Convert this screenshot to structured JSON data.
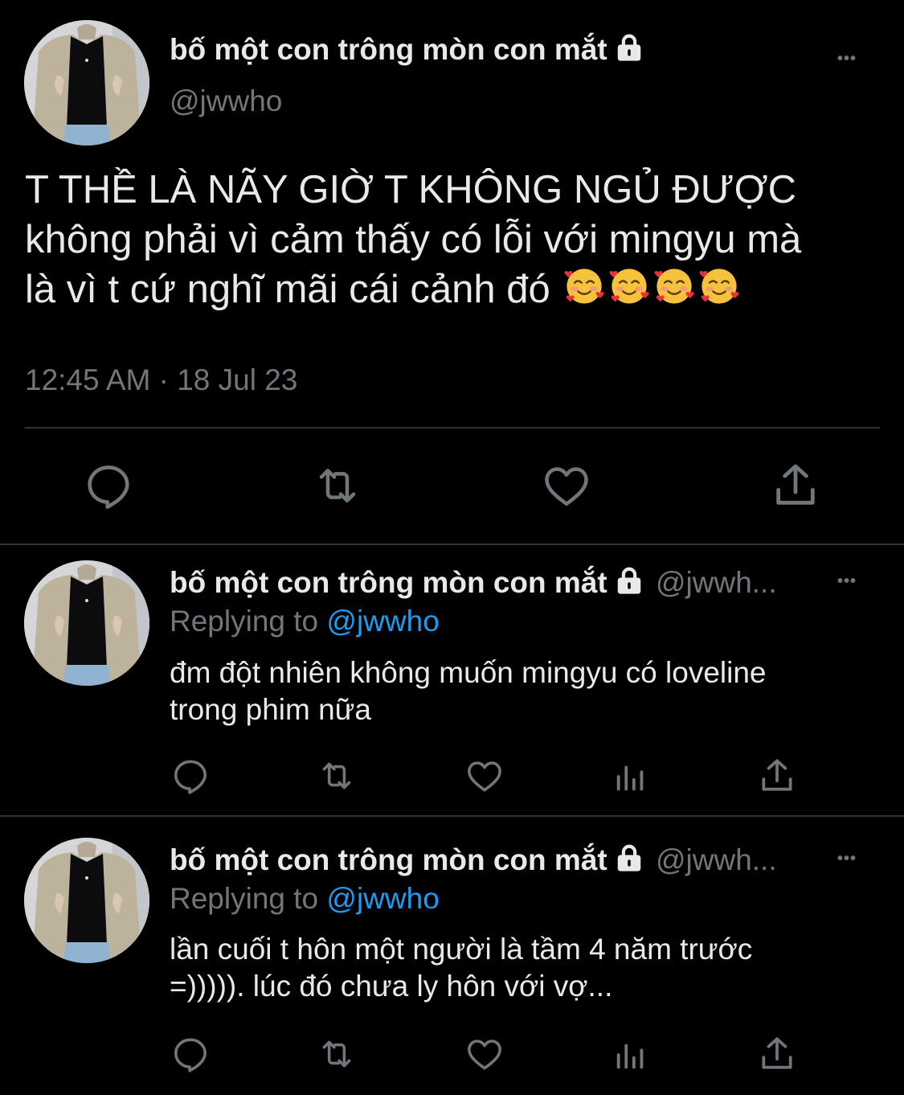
{
  "main_tweet": {
    "display_name": "bố một con trông mòn con mắt",
    "handle": "@jwwho",
    "text_line1": "T THỀ LÀ NÃY GIỜ T KHÔNG NGỦ ĐƯỢC",
    "text_line2": "không phải vì cảm thấy có lỗi với mingyu mà",
    "text_line3": "là vì t cứ nghĩ mãi cái cảnh đó",
    "emojis": [
      "smiling-face-with-hearts",
      "smiling-face-with-hearts",
      "smiling-face-with-hearts",
      "smiling-face-with-hearts"
    ],
    "timestamp": "12:45 AM · 18 Jul 23",
    "more": "•••"
  },
  "replies": [
    {
      "display_name": "bố một con trông mòn con mắt",
      "handle": "@jwwh...",
      "replying_prefix": "Replying to",
      "replying_to": "@jwwho",
      "text_line1": "đm đột nhiên không muốn mingyu có loveline",
      "text_line2": "trong phim nữa",
      "more": "•••"
    },
    {
      "display_name": "bố một con trông mòn con mắt",
      "handle": "@jwwh...",
      "replying_prefix": "Replying to",
      "replying_to": "@jwwho",
      "text_line1": "lần cuối t hôn một người là tầm 4 năm trước",
      "text_line2": "=))))). lúc đó chưa ly hôn với vợ...",
      "more": "•••"
    }
  ],
  "colors": {
    "background": "#000000",
    "text": "#e7e9ea",
    "muted": "#71767b",
    "link": "#1d9bf0",
    "divider": "#2f3336"
  }
}
